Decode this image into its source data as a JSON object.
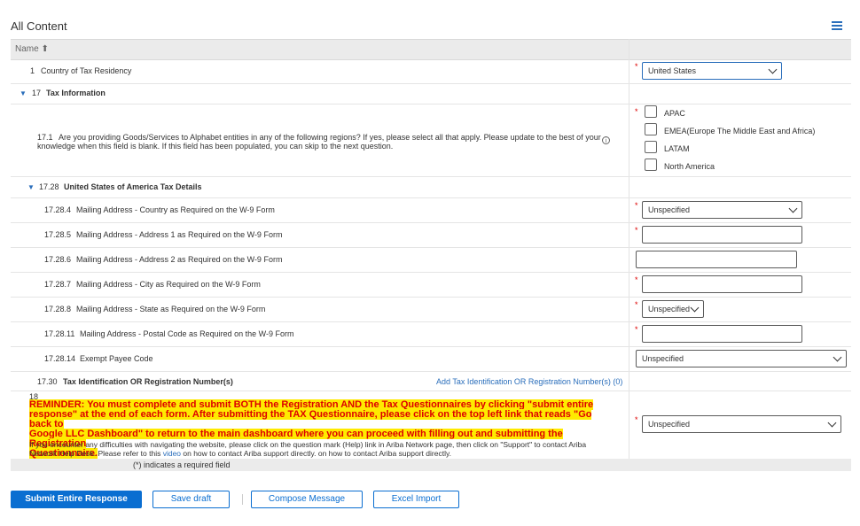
{
  "page": {
    "title": "All Content"
  },
  "table": {
    "header_name": "Name ⬆",
    "rows": {
      "country": {
        "number": "1",
        "label": "Country of Tax Residency",
        "value": "United States"
      },
      "tax_info": {
        "number": "17",
        "label": "Tax Information"
      },
      "regions": {
        "number": "17.1",
        "question_line1": "Are you providing Goods/Services to Alphabet entities in any of the following regions? If yes, please select all that apply. Please update to the best of your",
        "question_line2": "knowledge when this field is blank. If this field has been populated, you can skip to the next question.",
        "options": [
          "APAC",
          "EMEA(Europe The Middle East and Africa)",
          "LATAM",
          "North America"
        ]
      },
      "usa": {
        "number": "17.28",
        "label": "United States of America Tax Details"
      },
      "country_w9": {
        "number": "17.28.4",
        "label": "Mailing Address - Country as Required on the W-9 Form",
        "value": "Unspecified"
      },
      "addr1": {
        "number": "17.28.5",
        "label": "Mailing Address - Address 1 as Required on the W-9 Form"
      },
      "addr2": {
        "number": "17.28.6",
        "label": "Mailing Address - Address 2 as Required on the W-9 Form"
      },
      "city": {
        "number": "17.28.7",
        "label": "Mailing Address - City as Required on the W-9 Form"
      },
      "state": {
        "number": "17.28.8",
        "label": "Mailing Address - State as Required on the W-9 Form",
        "value": "Unspecified"
      },
      "postal": {
        "number": "17.28.11",
        "label": "Mailing Address - Postal Code as Required on the W-9 Form"
      },
      "exempt": {
        "number": "17.28.14",
        "label": "Exempt Payee Code",
        "value": "Unspecified"
      },
      "tin": {
        "number": "17.30",
        "label": "Tax Identification OR Registration Number(s)",
        "link": "Add Tax Identification OR Registration Number(s) (0)"
      },
      "reminder": {
        "number": "18",
        "line1": "REMINDER: You must complete and submit BOTH the Registration  AND the Tax Questionnaires by clicking \"submit entire",
        "line2": "response\" at the end of each form. After submitting the TAX Questionnaire, please click on the top left link that reads \"Go back to",
        "line3": "Google LLC Dashboard\" to return to the main dashboard where you can proceed with filling out and submitting the Registration",
        "line4": "Questionnaire.",
        "help_line1": "If you encounter any difficulties with navigating the website, please click on the question mark (Help) link in Ariba Network page, then click on \"Support\" to contact Ariba",
        "help_line2_pre": "Network Help Desk. Please refer to this ",
        "help_link": "video",
        "help_line2_post": " on how to contact Ariba support directly. on how to contact Ariba support directly.",
        "value": "Unspecified"
      }
    },
    "required_note": "(*) indicates a required field",
    "required_mark": "*"
  },
  "buttons": {
    "submit": "Submit Entire Response",
    "save": "Save draft",
    "compose": "Compose Message",
    "excel": "Excel Import"
  },
  "colors": {
    "accent": "#0a6ed1",
    "required": "#dd0000",
    "highlight": "#ffea00"
  }
}
